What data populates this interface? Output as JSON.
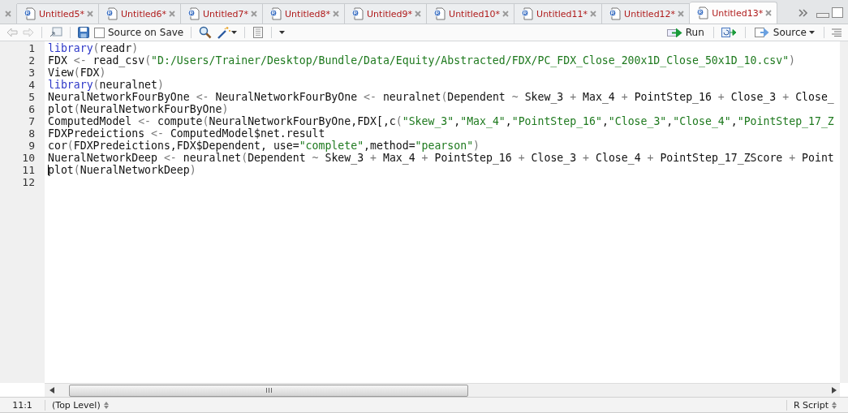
{
  "tabs": [
    {
      "label": "Untitled5*",
      "selected": false
    },
    {
      "label": "Untitled6*",
      "selected": false
    },
    {
      "label": "Untitled7*",
      "selected": false
    },
    {
      "label": "Untitled8*",
      "selected": false
    },
    {
      "label": "Untitled9*",
      "selected": false
    },
    {
      "label": "Untitled10*",
      "selected": false
    },
    {
      "label": "Untitled11*",
      "selected": false
    },
    {
      "label": "Untitled12*",
      "selected": false
    },
    {
      "label": "Untitled13*",
      "selected": true
    }
  ],
  "toolbar": {
    "source_on_save": {
      "label": "Source on Save",
      "checked": false
    },
    "run": "Run",
    "source": "Source"
  },
  "editor": {
    "lines": [
      {
        "number": "1",
        "cursor": false,
        "tokens": [
          {
            "kind": "fn",
            "text": "library"
          },
          {
            "kind": "op",
            "text": "("
          },
          {
            "kind": "id",
            "text": "readr"
          },
          {
            "kind": "op",
            "text": ")"
          }
        ]
      },
      {
        "number": "2",
        "cursor": false,
        "tokens": [
          {
            "kind": "id",
            "text": "FDX "
          },
          {
            "kind": "op",
            "text": "<- "
          },
          {
            "kind": "id",
            "text": "read_csv"
          },
          {
            "kind": "op",
            "text": "("
          },
          {
            "kind": "str",
            "text": "\"D:/Users/Trainer/Desktop/Bundle/Data/Equity/Abstracted/FDX/PC_FDX_Close_200x1D_Close_50x1D_10.csv\""
          },
          {
            "kind": "op",
            "text": ")"
          }
        ]
      },
      {
        "number": "3",
        "cursor": false,
        "tokens": [
          {
            "kind": "id",
            "text": "View"
          },
          {
            "kind": "op",
            "text": "("
          },
          {
            "kind": "id",
            "text": "FDX"
          },
          {
            "kind": "op",
            "text": ")"
          }
        ]
      },
      {
        "number": "4",
        "cursor": false,
        "tokens": [
          {
            "kind": "fn",
            "text": "library"
          },
          {
            "kind": "op",
            "text": "("
          },
          {
            "kind": "id",
            "text": "neuralnet"
          },
          {
            "kind": "op",
            "text": ")"
          }
        ]
      },
      {
        "number": "5",
        "cursor": false,
        "tokens": [
          {
            "kind": "id",
            "text": "NeuralNetworkFourByOne "
          },
          {
            "kind": "op",
            "text": "<- "
          },
          {
            "kind": "id",
            "text": "NeuralNetworkFourByOne "
          },
          {
            "kind": "op",
            "text": "<- "
          },
          {
            "kind": "id",
            "text": "neuralnet"
          },
          {
            "kind": "op",
            "text": "("
          },
          {
            "kind": "id",
            "text": "Dependent "
          },
          {
            "kind": "op",
            "text": "~ "
          },
          {
            "kind": "id",
            "text": "Skew_3 "
          },
          {
            "kind": "op",
            "text": "+ "
          },
          {
            "kind": "id",
            "text": "Max_4 "
          },
          {
            "kind": "op",
            "text": "+ "
          },
          {
            "kind": "id",
            "text": "PointStep_16 "
          },
          {
            "kind": "op",
            "text": "+ "
          },
          {
            "kind": "id",
            "text": "Close_3 "
          },
          {
            "kind": "op",
            "text": "+ "
          },
          {
            "kind": "id",
            "text": "Close_"
          }
        ]
      },
      {
        "number": "6",
        "cursor": false,
        "tokens": [
          {
            "kind": "id",
            "text": "plot"
          },
          {
            "kind": "op",
            "text": "("
          },
          {
            "kind": "id",
            "text": "NeuralNetworkFourByOne"
          },
          {
            "kind": "op",
            "text": ")"
          }
        ]
      },
      {
        "number": "7",
        "cursor": false,
        "tokens": [
          {
            "kind": "id",
            "text": "ComputedModel "
          },
          {
            "kind": "op",
            "text": "<- "
          },
          {
            "kind": "id",
            "text": "compute"
          },
          {
            "kind": "op",
            "text": "("
          },
          {
            "kind": "id",
            "text": "NeuralNetworkFourByOne,FDX[,c"
          },
          {
            "kind": "op",
            "text": "("
          },
          {
            "kind": "str",
            "text": "\"Skew_3\""
          },
          {
            "kind": "id",
            "text": ","
          },
          {
            "kind": "str",
            "text": "\"Max_4\""
          },
          {
            "kind": "id",
            "text": ","
          },
          {
            "kind": "str",
            "text": "\"PointStep_16\""
          },
          {
            "kind": "id",
            "text": ","
          },
          {
            "kind": "str",
            "text": "\"Close_3\""
          },
          {
            "kind": "id",
            "text": ","
          },
          {
            "kind": "str",
            "text": "\"Close_4\""
          },
          {
            "kind": "id",
            "text": ","
          },
          {
            "kind": "str",
            "text": "\"PointStep_17_Z"
          }
        ]
      },
      {
        "number": "8",
        "cursor": false,
        "tokens": [
          {
            "kind": "id",
            "text": "FDXPredeictions "
          },
          {
            "kind": "op",
            "text": "<- "
          },
          {
            "kind": "id",
            "text": "ComputedModel$net.result"
          }
        ]
      },
      {
        "number": "9",
        "cursor": false,
        "tokens": [
          {
            "kind": "id",
            "text": "cor"
          },
          {
            "kind": "op",
            "text": "("
          },
          {
            "kind": "id",
            "text": "FDXPredeictions,FDX$Dependent, use="
          },
          {
            "kind": "str",
            "text": "\"complete\""
          },
          {
            "kind": "id",
            "text": ",method="
          },
          {
            "kind": "str",
            "text": "\"pearson\""
          },
          {
            "kind": "op",
            "text": ")"
          }
        ]
      },
      {
        "number": "10",
        "cursor": false,
        "tokens": [
          {
            "kind": "id",
            "text": "NueralNetworkDeep "
          },
          {
            "kind": "op",
            "text": "<- "
          },
          {
            "kind": "id",
            "text": "neuralnet"
          },
          {
            "kind": "op",
            "text": "("
          },
          {
            "kind": "id",
            "text": "Dependent "
          },
          {
            "kind": "op",
            "text": "~ "
          },
          {
            "kind": "id",
            "text": "Skew_3 "
          },
          {
            "kind": "op",
            "text": "+ "
          },
          {
            "kind": "id",
            "text": "Max_4 "
          },
          {
            "kind": "op",
            "text": "+ "
          },
          {
            "kind": "id",
            "text": "PointStep_16 "
          },
          {
            "kind": "op",
            "text": "+ "
          },
          {
            "kind": "id",
            "text": "Close_3 "
          },
          {
            "kind": "op",
            "text": "+ "
          },
          {
            "kind": "id",
            "text": "Close_4 "
          },
          {
            "kind": "op",
            "text": "+ "
          },
          {
            "kind": "id",
            "text": "PointStep_17_ZScore "
          },
          {
            "kind": "op",
            "text": "+ "
          },
          {
            "kind": "id",
            "text": "Point"
          }
        ]
      },
      {
        "number": "11",
        "cursor": true,
        "tokens": [
          {
            "kind": "id",
            "text": "plot"
          },
          {
            "kind": "op",
            "text": "("
          },
          {
            "kind": "id",
            "text": "NueralNetworkDeep"
          },
          {
            "kind": "op",
            "text": ")"
          }
        ]
      },
      {
        "number": "12",
        "cursor": false
      }
    ]
  },
  "status_bar": {
    "position": "11:1",
    "scope": "(Top Level)",
    "file_type": "R Script"
  }
}
